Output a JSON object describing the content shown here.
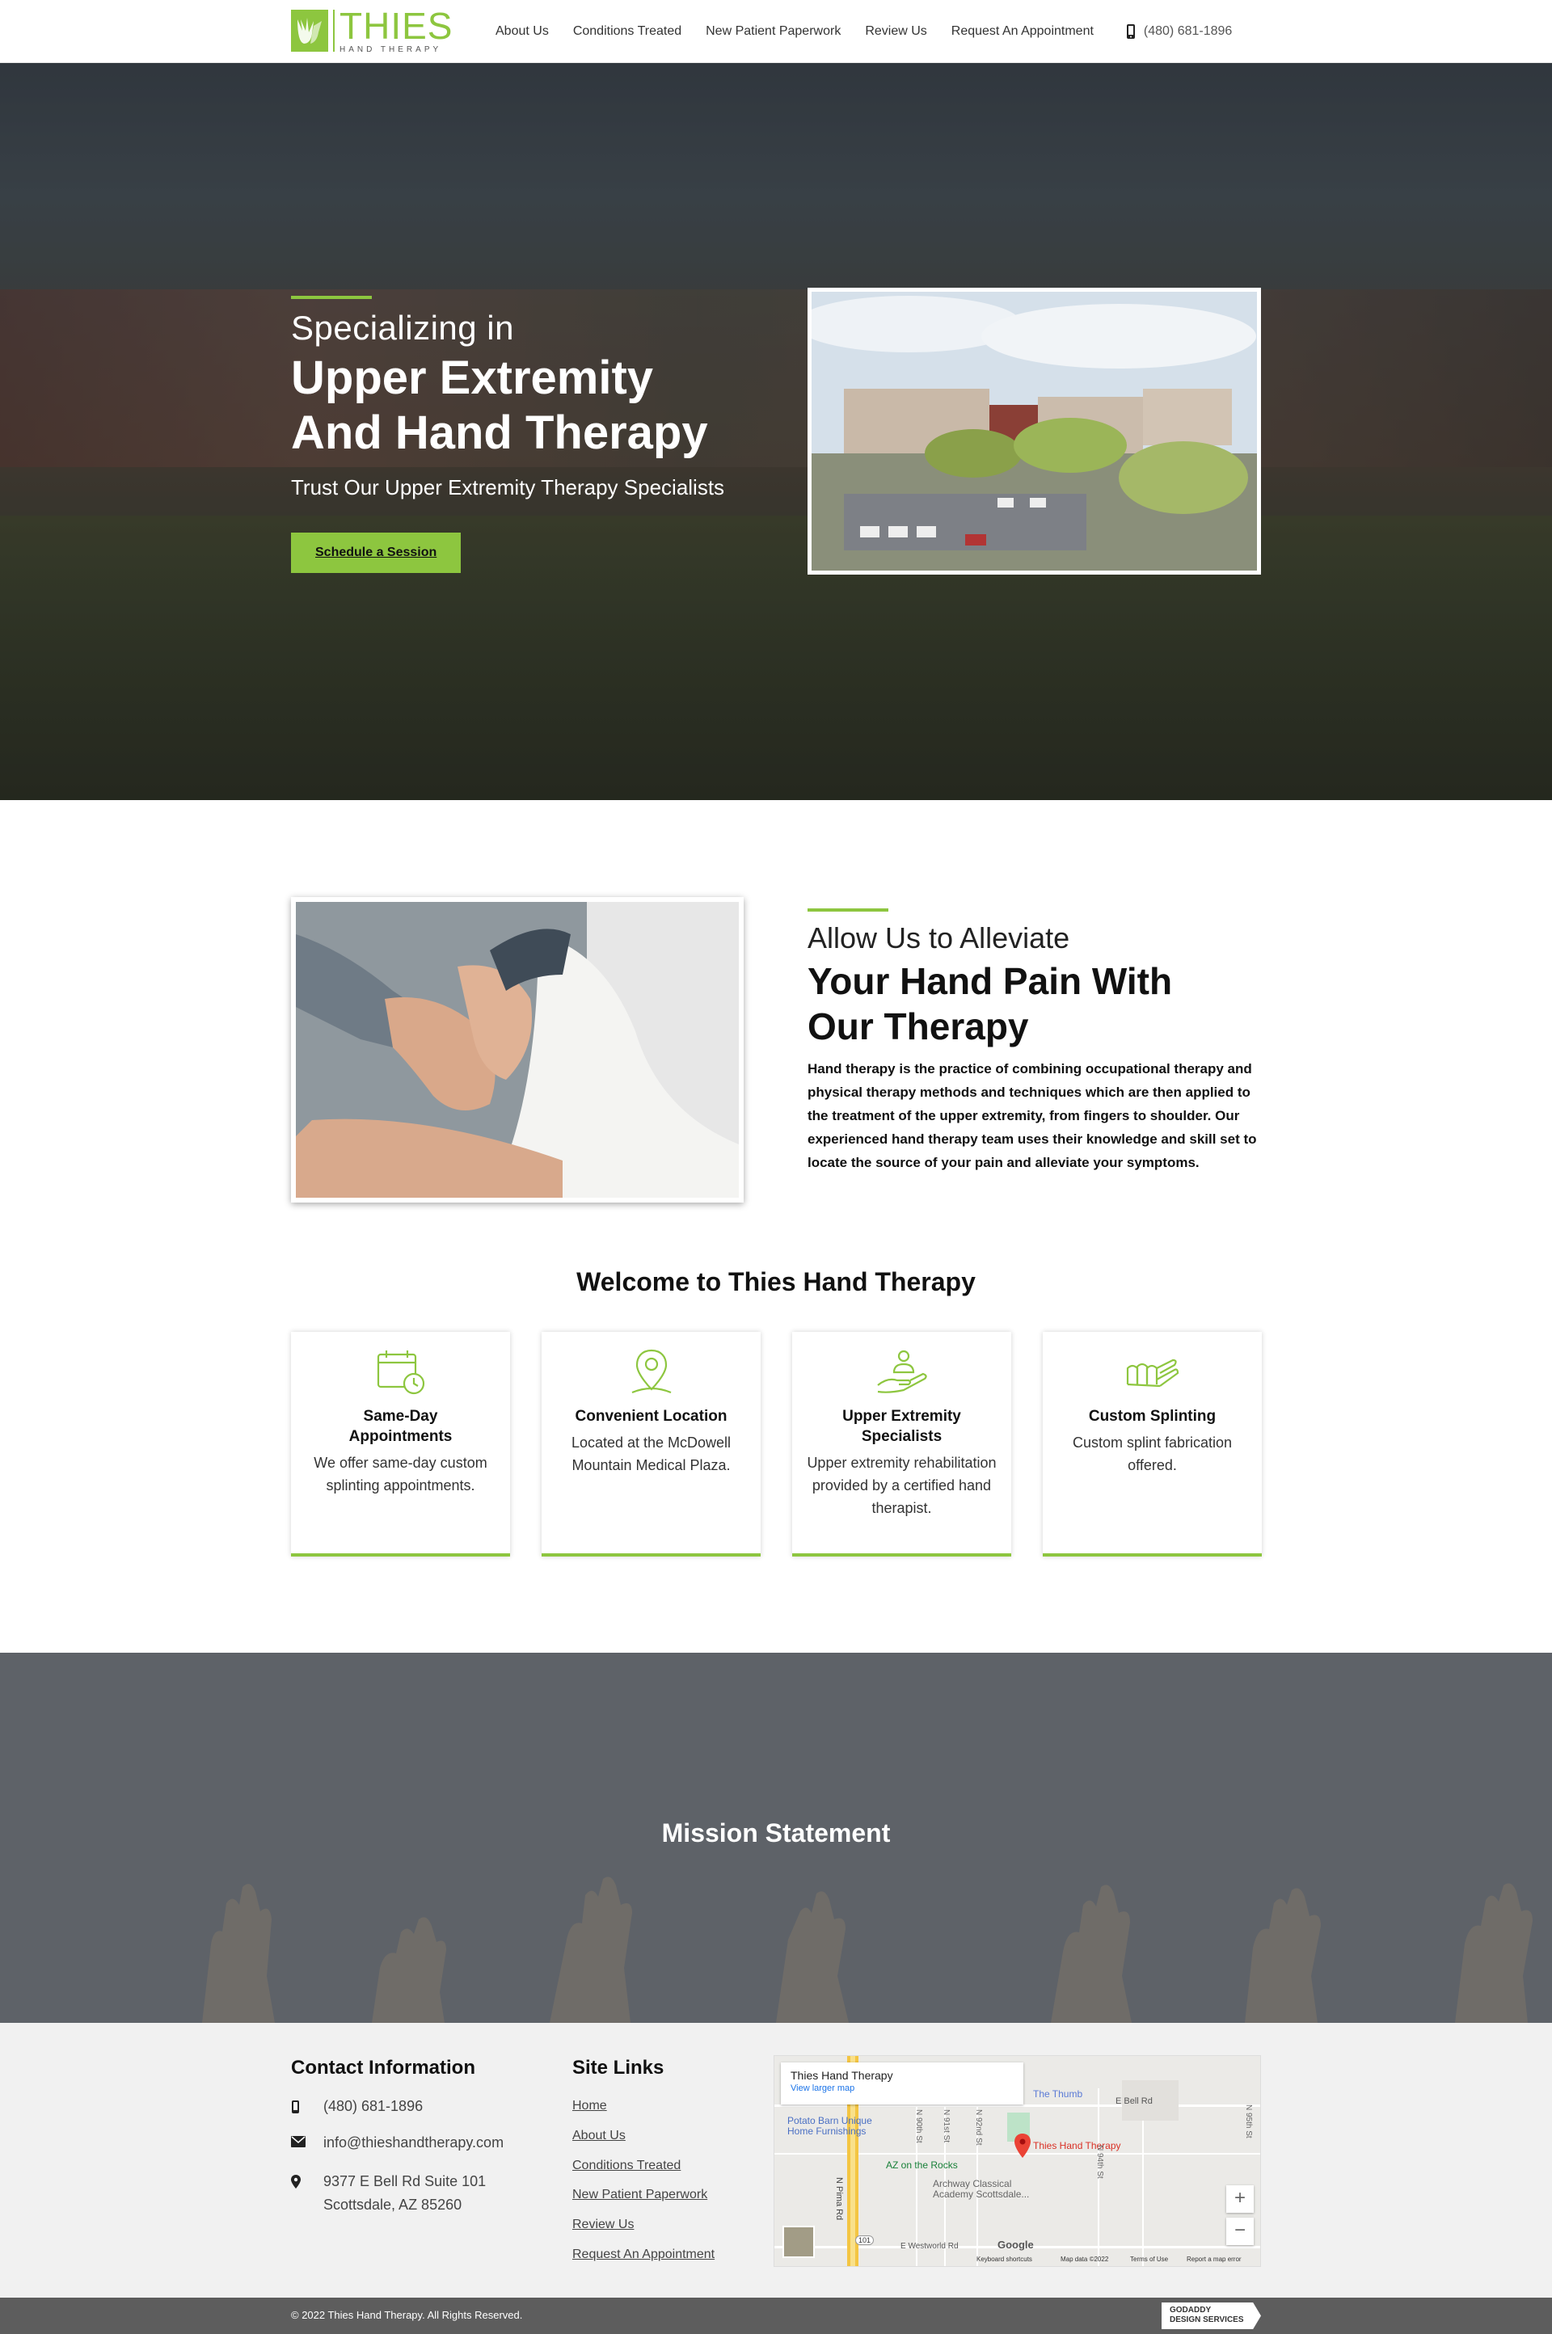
{
  "header": {
    "logo_title": "THIES",
    "logo_subtitle": "HAND THERAPY",
    "nav": [
      "About Us",
      "Conditions Treated",
      "New Patient Paperwork",
      "Review Us",
      "Request An Appointment"
    ],
    "phone": "(480) 681-1896"
  },
  "hero": {
    "pre": "Specializing in",
    "title_line1": "Upper Extremity",
    "title_line2": "And Hand Therapy",
    "subtitle": "Trust Our Upper Extremity Therapy Specialists",
    "cta": "Schedule a Session"
  },
  "about": {
    "pre": "Allow Us to Alleviate",
    "title_line1": "Your Hand Pain With",
    "title_line2": "Our Therapy",
    "body": "Hand therapy is the practice of combining occupational therapy and physical therapy methods and techniques which are then applied to the treatment of the upper extremity, from fingers to shoulder. Our experienced hand therapy team uses their knowledge and skill set to locate the source of your pain and alleviate your symptoms."
  },
  "welcome": {
    "title": "Welcome to Thies Hand Therapy",
    "cards": [
      {
        "icon": "calendar-clock-icon",
        "title": "Same-Day Appointments",
        "body": "We offer same-day custom splinting appointments."
      },
      {
        "icon": "location-pin-icon",
        "title": "Convenient Location",
        "body": "Located at the McDowell Mountain Medical Plaza."
      },
      {
        "icon": "hand-care-icon",
        "title": "Upper Extremity Specialists",
        "body": "Upper extremity rehabilitation provided by a certified hand therapist."
      },
      {
        "icon": "splint-hand-icon",
        "title": "Custom Splinting",
        "body": "Custom splint fabrication offered."
      }
    ]
  },
  "mission": {
    "title": "Mission Statement"
  },
  "footer": {
    "contact_title": "Contact Information",
    "phone": "(480) 681-1896",
    "email": "info@thieshandtherapy.com",
    "address_line1": "9377 E Bell Rd Suite 101",
    "address_line2": "Scottsdale, AZ 85260",
    "links_title": "Site Links",
    "links": [
      "Home",
      "About Us",
      "Conditions Treated",
      "New Patient Paperwork",
      "Review Us",
      "Request An Appointment"
    ],
    "map": {
      "place": "Thies Hand Therapy",
      "view_larger": "View larger map",
      "labels": {
        "thumb": "The Thumb",
        "bell": "E Bell Rd",
        "potato": "Potato Barn Unique Home Furnishings",
        "marker": "Thies Hand Therapy",
        "rocks": "AZ on the Rocks",
        "archway": "Archway Classical Academy Scottsdale...",
        "pima": "N Pima Rd",
        "westworld": "E Westworld Rd",
        "n90": "N 90th St",
        "n91": "N 91st St",
        "n92": "N 92nd St",
        "n94": "N 94th St",
        "n95": "N 95th St",
        "hwy": "101",
        "google": "Google",
        "keyboard": "Keyboard shortcuts",
        "mapdata": "Map data ©2022",
        "terms": "Terms of Use",
        "report": "Report a map error"
      }
    }
  },
  "bottom": {
    "copyright": "© 2022 Thies Hand Therapy. All Rights Reserved.",
    "badge_line1": "GODADDY",
    "badge_line2": "DESIGN SERVICES"
  },
  "colors": {
    "accent": "#8dc63f",
    "mission_bg": "#5e6268",
    "footer_bg": "#f1f1f1",
    "bottom_bg": "#5d5d5d"
  }
}
